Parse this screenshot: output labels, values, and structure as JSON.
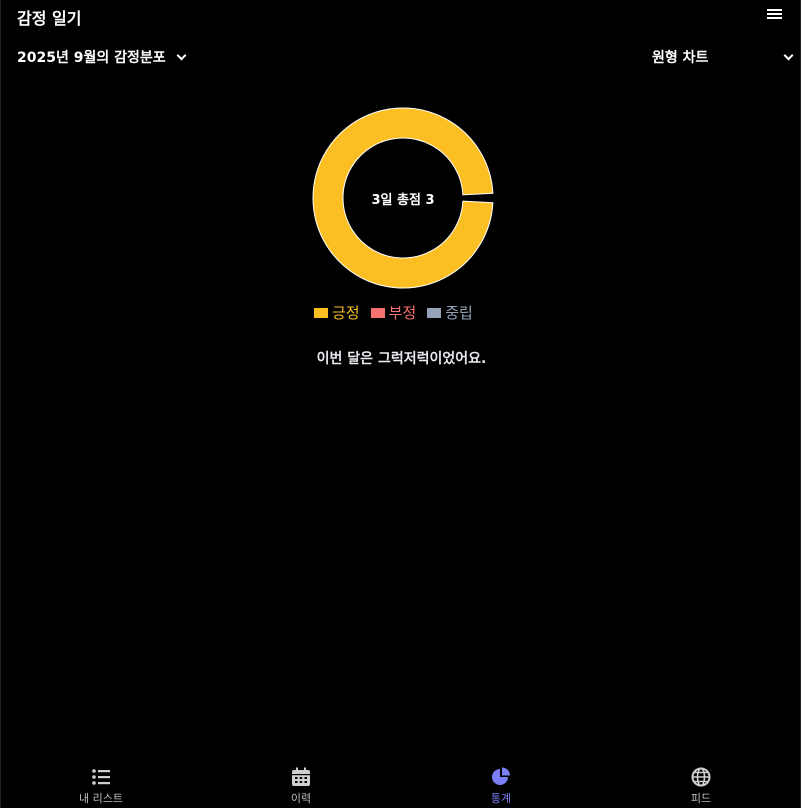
{
  "header": {
    "title": "감정 일기",
    "menu_icon": "menu-icon"
  },
  "filters": {
    "period_label": "2025년 9월의 감정분포",
    "chart_type_label": "원형 차트"
  },
  "chart": {
    "center_label": "3일 총점 3"
  },
  "chart_data": {
    "type": "pie",
    "categories": [
      "긍정",
      "부정",
      "중립"
    ],
    "values": [
      3,
      0,
      0
    ],
    "colors": [
      "#fbbf24",
      "#f87171",
      "#94a3b8"
    ],
    "donut": true
  },
  "legend": [
    {
      "label": "긍정",
      "color": "#fbbf24"
    },
    {
      "label": "부정",
      "color": "#f87171"
    },
    {
      "label": "중립",
      "color": "#94a3b8"
    }
  ],
  "summary": "이번 달은 그럭저럭이었어요.",
  "nav": {
    "active_color": "#7b7ff5",
    "items": [
      {
        "label": "내 리스트",
        "icon": "list-icon",
        "active": false
      },
      {
        "label": "이력",
        "icon": "calendar-icon",
        "active": false
      },
      {
        "label": "통계",
        "icon": "pie-chart-icon",
        "active": true
      },
      {
        "label": "피드",
        "icon": "globe-icon",
        "active": false
      }
    ]
  }
}
